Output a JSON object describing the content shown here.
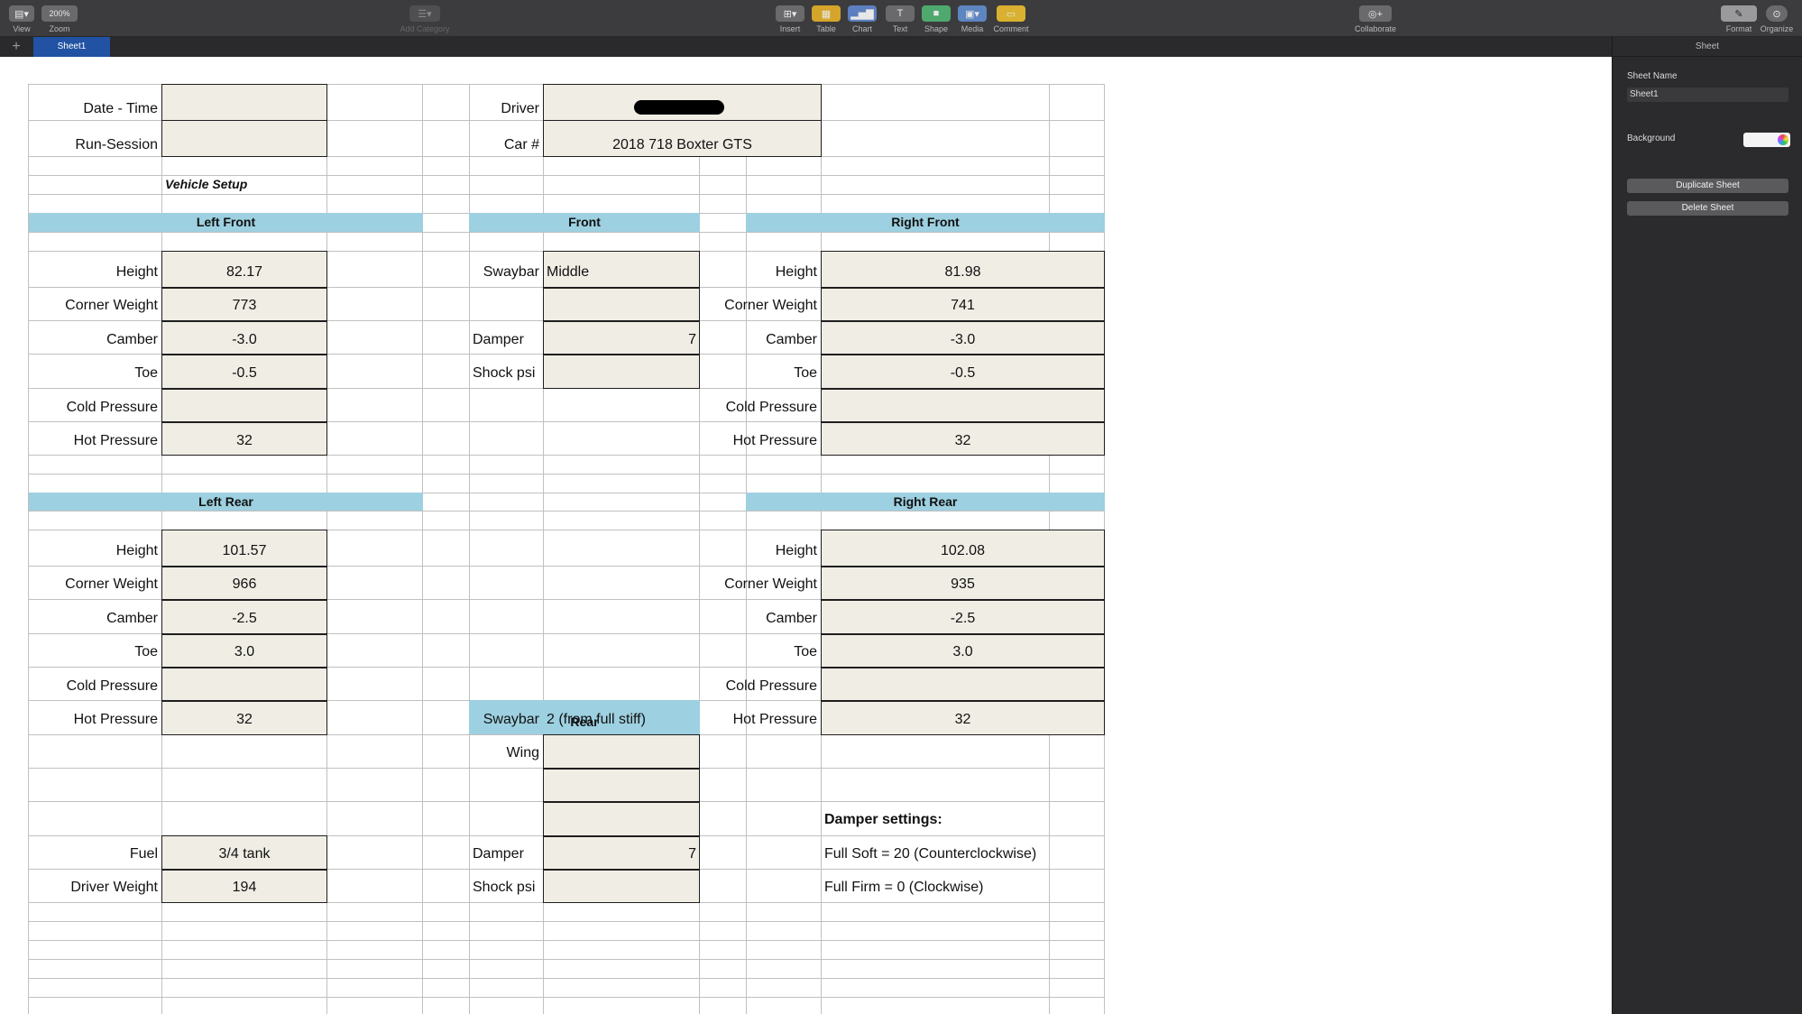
{
  "toolbar": {
    "view": "View",
    "zoom_value": "200%",
    "zoom": "Zoom",
    "add_category": "Add Category",
    "insert": "Insert",
    "table": "Table",
    "chart": "Chart",
    "text": "Text",
    "shape": "Shape",
    "media": "Media",
    "comment": "Comment",
    "collaborate": "Collaborate",
    "format": "Format",
    "organize": "Organize"
  },
  "tabs": {
    "add": "+",
    "sheet1": "Sheet1"
  },
  "sidebar": {
    "header": "Sheet",
    "sheet_name_label": "Sheet Name",
    "sheet_name_value": "Sheet1",
    "background_label": "Background",
    "background_color": "#ffffff",
    "duplicate": "Duplicate Sheet",
    "delete": "Delete Sheet"
  },
  "sheet": {
    "date_time": "Date - Time",
    "run_session": "Run-Session",
    "driver": "Driver",
    "car_num": "Car #",
    "car_value": "2018 718 Boxter GTS",
    "vehicle_setup": "Vehicle Setup",
    "headers": {
      "lf": "Left Front",
      "front": "Front",
      "rf": "Right Front",
      "lr": "Left Rear",
      "rr": "Right Rear",
      "rear": "Rear"
    },
    "labels": {
      "height": "Height",
      "corner_weight": "Corner Weight",
      "camber": "Camber",
      "toe": "Toe",
      "cold": "Cold Pressure",
      "hot": "Hot Pressure",
      "swaybar": "Swaybar",
      "damper": "Damper",
      "shock": "Shock psi",
      "wing": "Wing",
      "fuel": "Fuel",
      "driver_weight": "Driver Weight"
    },
    "lf": {
      "height": "82.17",
      "cw": "773",
      "camber": "-3.0",
      "toe": "-0.5",
      "cold": "",
      "hot": "32"
    },
    "rf": {
      "height": "81.98",
      "cw": "741",
      "camber": "-3.0",
      "toe": "-0.5",
      "cold": "",
      "hot": "32"
    },
    "lr": {
      "height": "101.57",
      "cw": "966",
      "camber": "-2.5",
      "toe": "3.0",
      "cold": "",
      "hot": "32"
    },
    "rr": {
      "height": "102.08",
      "cw": "935",
      "camber": "-2.5",
      "toe": "3.0",
      "cold": "",
      "hot": "32"
    },
    "front": {
      "swaybar": "Middle",
      "damper": "7",
      "shock": ""
    },
    "rear": {
      "swaybar": "2 (from full stiff)",
      "wing": "",
      "damper": "7",
      "shock": ""
    },
    "fuel": "3/4 tank",
    "driver_weight": "194",
    "damper_settings": "Damper settings:",
    "full_soft": "Full Soft = 20 (Counterclockwise)",
    "full_firm": "Full Firm = 0 (Clockwise)"
  }
}
